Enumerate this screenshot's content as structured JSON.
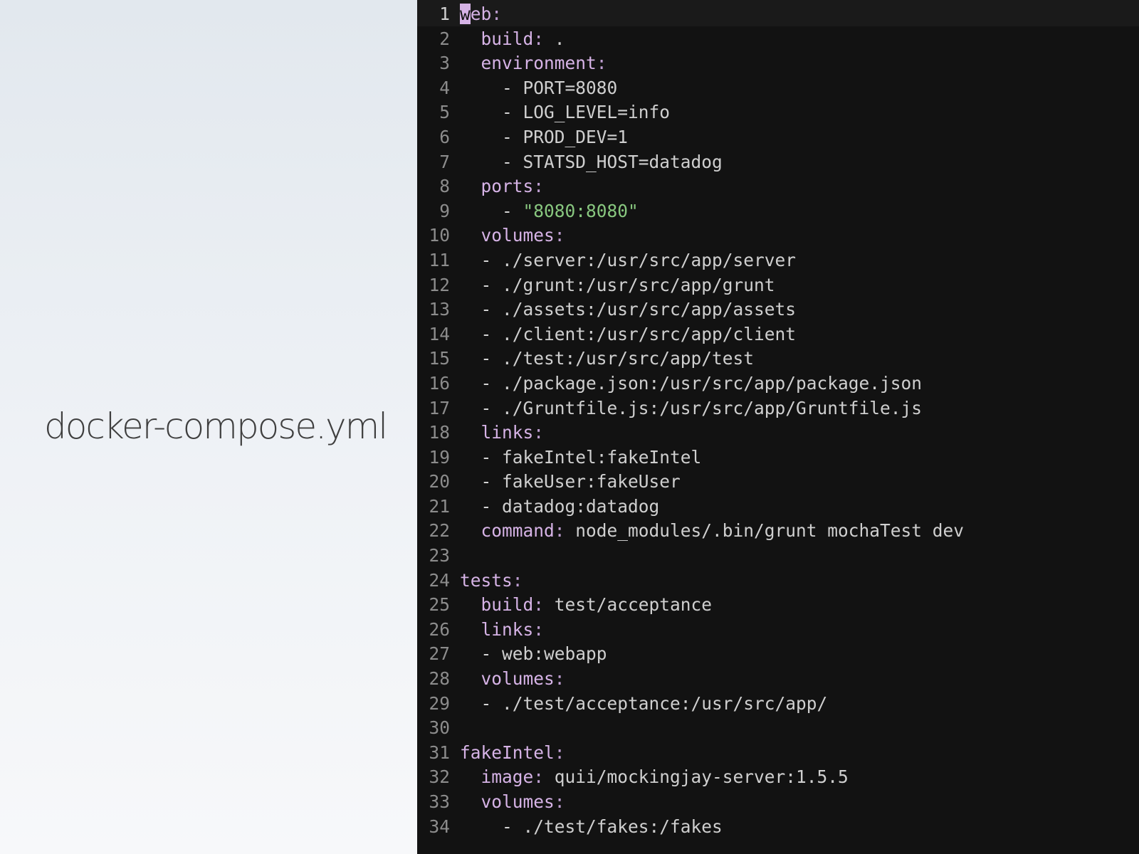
{
  "slide": {
    "title": "docker-compose.yml"
  },
  "editor": {
    "current_line": 1,
    "lines": [
      {
        "num": "1",
        "indent": "",
        "key": "web",
        "colon": ":",
        "dash": "",
        "value": "",
        "str": ""
      },
      {
        "num": "2",
        "indent": "  ",
        "key": "build",
        "colon": ":",
        "dash": "",
        "value": " .",
        "str": ""
      },
      {
        "num": "3",
        "indent": "  ",
        "key": "environment",
        "colon": ":",
        "dash": "",
        "value": "",
        "str": ""
      },
      {
        "num": "4",
        "indent": "    ",
        "key": "",
        "colon": "",
        "dash": "- ",
        "value": "PORT=8080",
        "str": ""
      },
      {
        "num": "5",
        "indent": "    ",
        "key": "",
        "colon": "",
        "dash": "- ",
        "value": "LOG_LEVEL=info",
        "str": ""
      },
      {
        "num": "6",
        "indent": "    ",
        "key": "",
        "colon": "",
        "dash": "- ",
        "value": "PROD_DEV=1",
        "str": ""
      },
      {
        "num": "7",
        "indent": "    ",
        "key": "",
        "colon": "",
        "dash": "- ",
        "value": "STATSD_HOST=datadog",
        "str": ""
      },
      {
        "num": "8",
        "indent": "  ",
        "key": "ports",
        "colon": ":",
        "dash": "",
        "value": "",
        "str": ""
      },
      {
        "num": "9",
        "indent": "    ",
        "key": "",
        "colon": "",
        "dash": "- ",
        "value": "",
        "str": "\"8080:8080\""
      },
      {
        "num": "10",
        "indent": "  ",
        "key": "volumes",
        "colon": ":",
        "dash": "",
        "value": "",
        "str": ""
      },
      {
        "num": "11",
        "indent": "  ",
        "key": "",
        "colon": "",
        "dash": "- ",
        "value": "./server:/usr/src/app/server",
        "str": ""
      },
      {
        "num": "12",
        "indent": "  ",
        "key": "",
        "colon": "",
        "dash": "- ",
        "value": "./grunt:/usr/src/app/grunt",
        "str": ""
      },
      {
        "num": "13",
        "indent": "  ",
        "key": "",
        "colon": "",
        "dash": "- ",
        "value": "./assets:/usr/src/app/assets",
        "str": ""
      },
      {
        "num": "14",
        "indent": "  ",
        "key": "",
        "colon": "",
        "dash": "- ",
        "value": "./client:/usr/src/app/client",
        "str": ""
      },
      {
        "num": "15",
        "indent": "  ",
        "key": "",
        "colon": "",
        "dash": "- ",
        "value": "./test:/usr/src/app/test",
        "str": ""
      },
      {
        "num": "16",
        "indent": "  ",
        "key": "",
        "colon": "",
        "dash": "- ",
        "value": "./package.json:/usr/src/app/package.json",
        "str": ""
      },
      {
        "num": "17",
        "indent": "  ",
        "key": "",
        "colon": "",
        "dash": "- ",
        "value": "./Gruntfile.js:/usr/src/app/Gruntfile.js",
        "str": ""
      },
      {
        "num": "18",
        "indent": "  ",
        "key": "links",
        "colon": ":",
        "dash": "",
        "value": "",
        "str": ""
      },
      {
        "num": "19",
        "indent": "  ",
        "key": "",
        "colon": "",
        "dash": "- ",
        "value": "fakeIntel:fakeIntel",
        "str": ""
      },
      {
        "num": "20",
        "indent": "  ",
        "key": "",
        "colon": "",
        "dash": "- ",
        "value": "fakeUser:fakeUser",
        "str": ""
      },
      {
        "num": "21",
        "indent": "  ",
        "key": "",
        "colon": "",
        "dash": "- ",
        "value": "datadog:datadog",
        "str": ""
      },
      {
        "num": "22",
        "indent": "  ",
        "key": "command",
        "colon": ":",
        "dash": "",
        "value": " node_modules/.bin/grunt mochaTest dev",
        "str": ""
      },
      {
        "num": "23",
        "indent": "",
        "key": "",
        "colon": "",
        "dash": "",
        "value": "",
        "str": ""
      },
      {
        "num": "24",
        "indent": "",
        "key": "tests",
        "colon": ":",
        "dash": "",
        "value": "",
        "str": ""
      },
      {
        "num": "25",
        "indent": "  ",
        "key": "build",
        "colon": ":",
        "dash": "",
        "value": " test/acceptance",
        "str": ""
      },
      {
        "num": "26",
        "indent": "  ",
        "key": "links",
        "colon": ":",
        "dash": "",
        "value": "",
        "str": ""
      },
      {
        "num": "27",
        "indent": "  ",
        "key": "",
        "colon": "",
        "dash": "- ",
        "value": "web:webapp",
        "str": ""
      },
      {
        "num": "28",
        "indent": "  ",
        "key": "volumes",
        "colon": ":",
        "dash": "",
        "value": "",
        "str": ""
      },
      {
        "num": "29",
        "indent": "  ",
        "key": "",
        "colon": "",
        "dash": "- ",
        "value": "./test/acceptance:/usr/src/app/",
        "str": ""
      },
      {
        "num": "30",
        "indent": "",
        "key": "",
        "colon": "",
        "dash": "",
        "value": "",
        "str": ""
      },
      {
        "num": "31",
        "indent": "",
        "key": "fakeIntel",
        "colon": ":",
        "dash": "",
        "value": "",
        "str": ""
      },
      {
        "num": "32",
        "indent": "  ",
        "key": "image",
        "colon": ":",
        "dash": "",
        "value": " quii/mockingjay-server:1.5.5",
        "str": ""
      },
      {
        "num": "33",
        "indent": "  ",
        "key": "volumes",
        "colon": ":",
        "dash": "",
        "value": "",
        "str": ""
      },
      {
        "num": "34",
        "indent": "    ",
        "key": "",
        "colon": "",
        "dash": "- ",
        "value": "./test/fakes:/fakes",
        "str": ""
      }
    ]
  },
  "colors": {
    "editor_bg": "#121212",
    "key": "#d6b3e6",
    "string": "#88c77f",
    "text": "#cfcfcf",
    "line_number": "#8c8c8c"
  }
}
